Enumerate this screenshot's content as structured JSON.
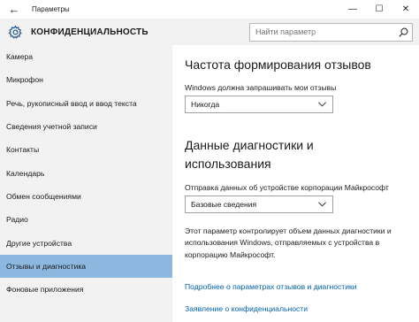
{
  "window": {
    "title": "Параметры",
    "back_glyph": "←",
    "minimize_glyph": "—",
    "maximize_glyph": "☐",
    "close_glyph": "✕"
  },
  "header": {
    "title": "КОНФИДЕНЦИАЛЬНОСТЬ",
    "search_placeholder": "Найти параметр",
    "icon": "gear-icon"
  },
  "sidebar": {
    "items": [
      {
        "label": "Камера"
      },
      {
        "label": "Микрофон"
      },
      {
        "label": "Речь, рукописный ввод и ввод текста"
      },
      {
        "label": "Сведения учетной записи"
      },
      {
        "label": "Контакты"
      },
      {
        "label": "Календарь"
      },
      {
        "label": "Обмен сообщениями"
      },
      {
        "label": "Радио"
      },
      {
        "label": "Другие устройства"
      },
      {
        "label": "Отзывы и диагностика",
        "active": true
      },
      {
        "label": "Фоновые приложения"
      }
    ]
  },
  "main": {
    "feedback": {
      "heading": "Частота формирования отзывов",
      "label": "Windows должна запрашивать мои отзывы",
      "selected": "Никогда"
    },
    "diagnostics": {
      "heading_line1": "Данные диагностики и",
      "heading_line2": "использования",
      "label": "Отправка данных об устройстве корпорации Майкрософт",
      "selected": "Базовые сведения",
      "description": "Этот параметр контролирует объем данных диагностики и использования Windows, отправляемых с устройства в корпорацию Майкрософт."
    },
    "links": {
      "more_info": "Подробнее о параметрах отзывов и диагностики",
      "privacy": "Заявление о конфиденциальности"
    }
  },
  "colors": {
    "accent_selected": "#8cb8df",
    "link": "#0063b1",
    "panel_bg": "#f2f2f2"
  }
}
